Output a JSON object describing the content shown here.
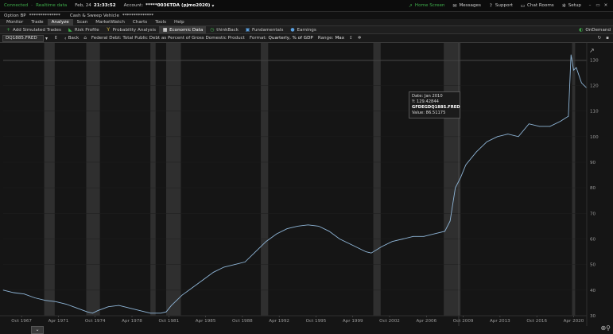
{
  "status": {
    "connected": "Connected",
    "data_mode": "Realtime data",
    "date": "Feb, 24",
    "time": "21:33:52",
    "account_label": "Account:",
    "account_value": "*****0036TDA (pjmo2020)",
    "home_screen": "Home Screen",
    "messages": "Messages",
    "support": "Support",
    "chat_rooms": "Chat Rooms",
    "setup": "Setup"
  },
  "account_bar": {
    "option_bp_label": "Option BP",
    "option_bp_value": "**************",
    "cash_label": "Cash & Sweep Vehicle",
    "cash_value": "**************"
  },
  "main_tabs": [
    "Monitor",
    "Trade",
    "Analyze",
    "Scan",
    "MarketWatch",
    "Charts",
    "Tools",
    "Help"
  ],
  "active_main_tab": "Analyze",
  "sub_tabs": [
    {
      "label": "Add Simulated Trades",
      "icon": "plus-icon"
    },
    {
      "label": "Risk Profile",
      "icon": "risk-profile-icon"
    },
    {
      "label": "Probability Analysis",
      "icon": "probability-icon"
    },
    {
      "label": "Economic Data",
      "icon": "economic-data-icon",
      "active": true
    },
    {
      "label": "thinkBack",
      "icon": "thinkback-icon"
    },
    {
      "label": "Fundamentals",
      "icon": "fundamentals-icon"
    },
    {
      "label": "Earnings",
      "icon": "earnings-icon"
    }
  ],
  "ondemand_label": "OnDemand",
  "toolbar": {
    "symbol": "DQ1885.FRED",
    "back_label": "Back",
    "series_title": "Federal Debt: Total Public Debt as Percent of Gross Domestic Product",
    "format_label": "Format:",
    "format_value": "Quarterly, % of GDP",
    "range_label": "Range:",
    "range_value": "Max"
  },
  "tooltip": {
    "date_label": "Date:",
    "date_value": "Jan 2010",
    "y_label": "Y:",
    "y_value": "129.42844",
    "symbol": "GFDEGDQ188S.FRED",
    "value_label": "Value:",
    "value_value": "86.51175"
  },
  "chart_data": {
    "type": "line",
    "xlabel_ticks": [
      "Oct 1967",
      "Apr 1971",
      "Oct 1974",
      "Apr 1978",
      "Oct 1981",
      "Apr 1985",
      "Oct 1988",
      "Apr 1992",
      "Oct 1995",
      "Apr 1999",
      "Oct 2002",
      "Apr 2006",
      "Oct 2009",
      "Apr 2013",
      "Oct 2016",
      "Apr 2020"
    ],
    "y_ticks": [
      30,
      40,
      50,
      60,
      70,
      80,
      90,
      100,
      110,
      120,
      130
    ],
    "ylim": [
      30,
      136
    ],
    "xlim": [
      1966.0,
      2021.5
    ],
    "recessions": [
      [
        1969.9,
        1970.9
      ],
      [
        1973.9,
        1975.2
      ],
      [
        1980.0,
        1980.5
      ],
      [
        1981.5,
        1982.9
      ],
      [
        1990.5,
        1991.2
      ],
      [
        2001.2,
        2001.9
      ],
      [
        2007.9,
        2009.5
      ],
      [
        2020.1,
        2020.4
      ]
    ],
    "series": [
      {
        "x": [
          1966.0,
          1967.0,
          1968.0,
          1969.0,
          1970.0,
          1971.0,
          1972.0,
          1973.0,
          1974.0,
          1974.5,
          1975.0,
          1976.0,
          1977.0,
          1978.0,
          1979.0,
          1980.0,
          1981.0,
          1981.5,
          1982.0,
          1983.0,
          1984.0,
          1985.0,
          1986.0,
          1987.0,
          1988.0,
          1989.0,
          1990.0,
          1991.0,
          1992.0,
          1993.0,
          1994.0,
          1995.0,
          1996.0,
          1997.0,
          1998.0,
          1999.0,
          2000.0,
          2000.5,
          2001.0,
          2002.0,
          2003.0,
          2004.0,
          2005.0,
          2006.0,
          2007.0,
          2008.0,
          2008.5,
          2009.0,
          2009.5,
          2010.0,
          2011.0,
          2012.0,
          2013.0,
          2014.0,
          2015.0,
          2016.0,
          2017.0,
          2018.0,
          2019.0,
          2019.75,
          2020.0,
          2020.25,
          2020.5,
          2021.0,
          2021.5
        ],
        "y": [
          40,
          39,
          38.5,
          37,
          36,
          35.5,
          34.5,
          33,
          31.5,
          31,
          32,
          33.5,
          34,
          33,
          32,
          31,
          31,
          31.5,
          34,
          38,
          41,
          44,
          47,
          49,
          50,
          51,
          55,
          59,
          62,
          64,
          65,
          65.5,
          65,
          63,
          60,
          58,
          56,
          55,
          54.5,
          57,
          59,
          60,
          61,
          61,
          62,
          63,
          67,
          80,
          84,
          89,
          94,
          98,
          100,
          101,
          100,
          105,
          104,
          104,
          106,
          108,
          132,
          126,
          127,
          121,
          119
        ]
      }
    ]
  }
}
